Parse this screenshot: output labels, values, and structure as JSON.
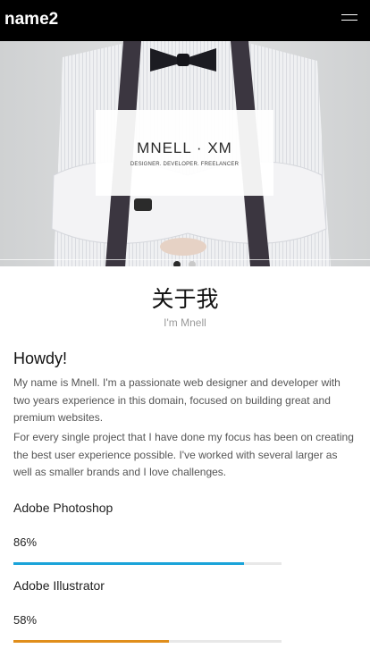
{
  "header": {
    "brand": "name2",
    "menu_icon": "hamburger-menu-icon"
  },
  "hero": {
    "title": "MNELL · XM",
    "subtitle": "DESIGNER. DEVELOPER. FREELANCER",
    "slide_count": 2,
    "active_slide": 1
  },
  "about": {
    "heading": "关于我",
    "subheading": "I'm Mnell",
    "greeting": "Howdy!",
    "paragraphs": [
      "My name is Mnell. I'm a passionate web designer and developer with two years experience in this domain, focused on building great and premium websites.",
      "For every single project that I have done my focus has been on creating the best user experience possible. I've worked with several larger as well as smaller brands and I love challenges."
    ]
  },
  "skills": [
    {
      "name": "Adobe Photoshop",
      "percent_label": "86%",
      "value": 0.86,
      "color": "#1aa3d9"
    },
    {
      "name": "Adobe Illustrator",
      "percent_label": "58%",
      "value": 0.58,
      "color": "#e08e1b"
    }
  ]
}
